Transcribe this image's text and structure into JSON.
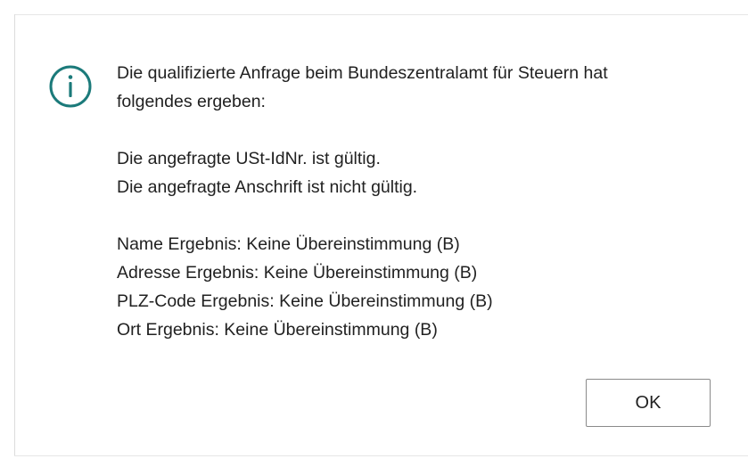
{
  "dialog": {
    "icon": "info-icon",
    "accent_color": "#1b7a7a",
    "message_lines": [
      "Die qualifizierte Anfrage beim Bundeszentralamt für Steuern hat",
      "folgendes ergeben:",
      "",
      "Die angefragte USt-IdNr. ist gültig.",
      "Die angefragte Anschrift ist nicht gültig.",
      "",
      "Name Ergebnis: Keine Übereinstimmung (B)",
      "Adresse Ergebnis: Keine Übereinstimmung (B)",
      "PLZ-Code Ergebnis: Keine Übereinstimmung (B)",
      "Ort Ergebnis: Keine Übereinstimmung (B)"
    ],
    "ok_label": "OK"
  }
}
